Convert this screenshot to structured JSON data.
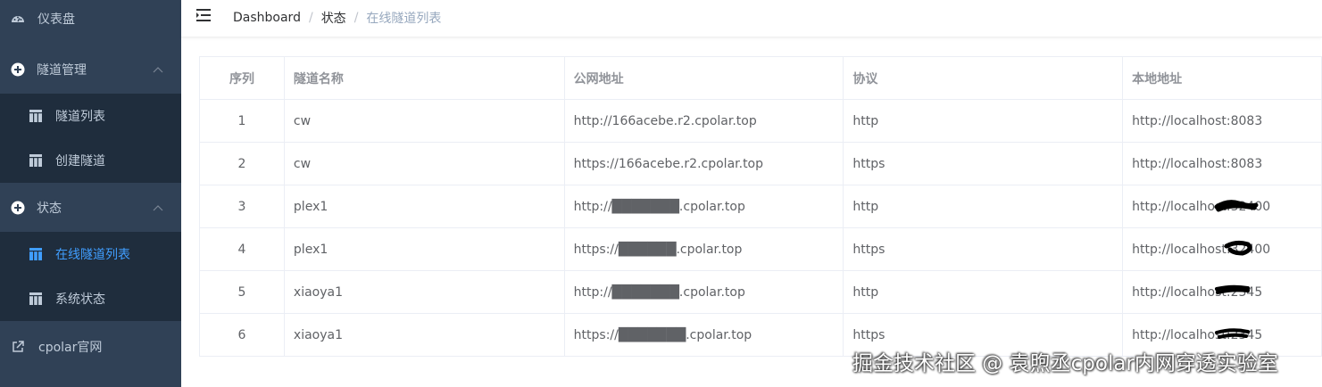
{
  "sidebar": {
    "items": [
      {
        "label": "仪表盘",
        "icon": "dashboard-icon"
      },
      {
        "label": "隧道管理",
        "icon": "plus-circle-icon"
      },
      {
        "label": "隧道列表",
        "icon": "grid-icon"
      },
      {
        "label": "创建隧道",
        "icon": "grid-icon"
      },
      {
        "label": "状态",
        "icon": "plus-circle-icon"
      },
      {
        "label": "在线隧道列表",
        "icon": "grid-icon"
      },
      {
        "label": "系统状态",
        "icon": "grid-icon"
      },
      {
        "label": "cpolar官网",
        "icon": "external-link-icon"
      }
    ]
  },
  "header": {
    "breadcrumb": [
      "Dashboard",
      "状态",
      "在线隧道列表"
    ],
    "separator": "/"
  },
  "table": {
    "columns": [
      "序列",
      "隧道名称",
      "公网地址",
      "协议",
      "本地地址"
    ],
    "rows": [
      [
        "1",
        "cw",
        "http://166acebe.r2.cpolar.top",
        "http",
        "http://localhost:8083"
      ],
      [
        "2",
        "cw",
        "https://166acebe.r2.cpolar.top",
        "https",
        "http://localhost:8083"
      ],
      [
        "3",
        "plex1",
        "http://███████.cpolar.top",
        "http",
        "http://localhost:32400"
      ],
      [
        "4",
        "plex1",
        "https://██████.cpolar.top",
        "https",
        "http://localhost:32400"
      ],
      [
        "5",
        "xiaoya1",
        "http://███████.cpolar.top",
        "http",
        "http://localhost:2345"
      ],
      [
        "6",
        "xiaoya1",
        "https://███████.cpolar.top",
        "https",
        "http://localhost:2345"
      ]
    ]
  },
  "watermark": "掘金技术社区 @ 袁煦丞cpolar内网穿透实验室",
  "colors": {
    "sidebar_bg": "#304156",
    "submenu_bg": "#1f2d3d",
    "active": "#409eff",
    "menu_text": "#bfcbd9"
  }
}
